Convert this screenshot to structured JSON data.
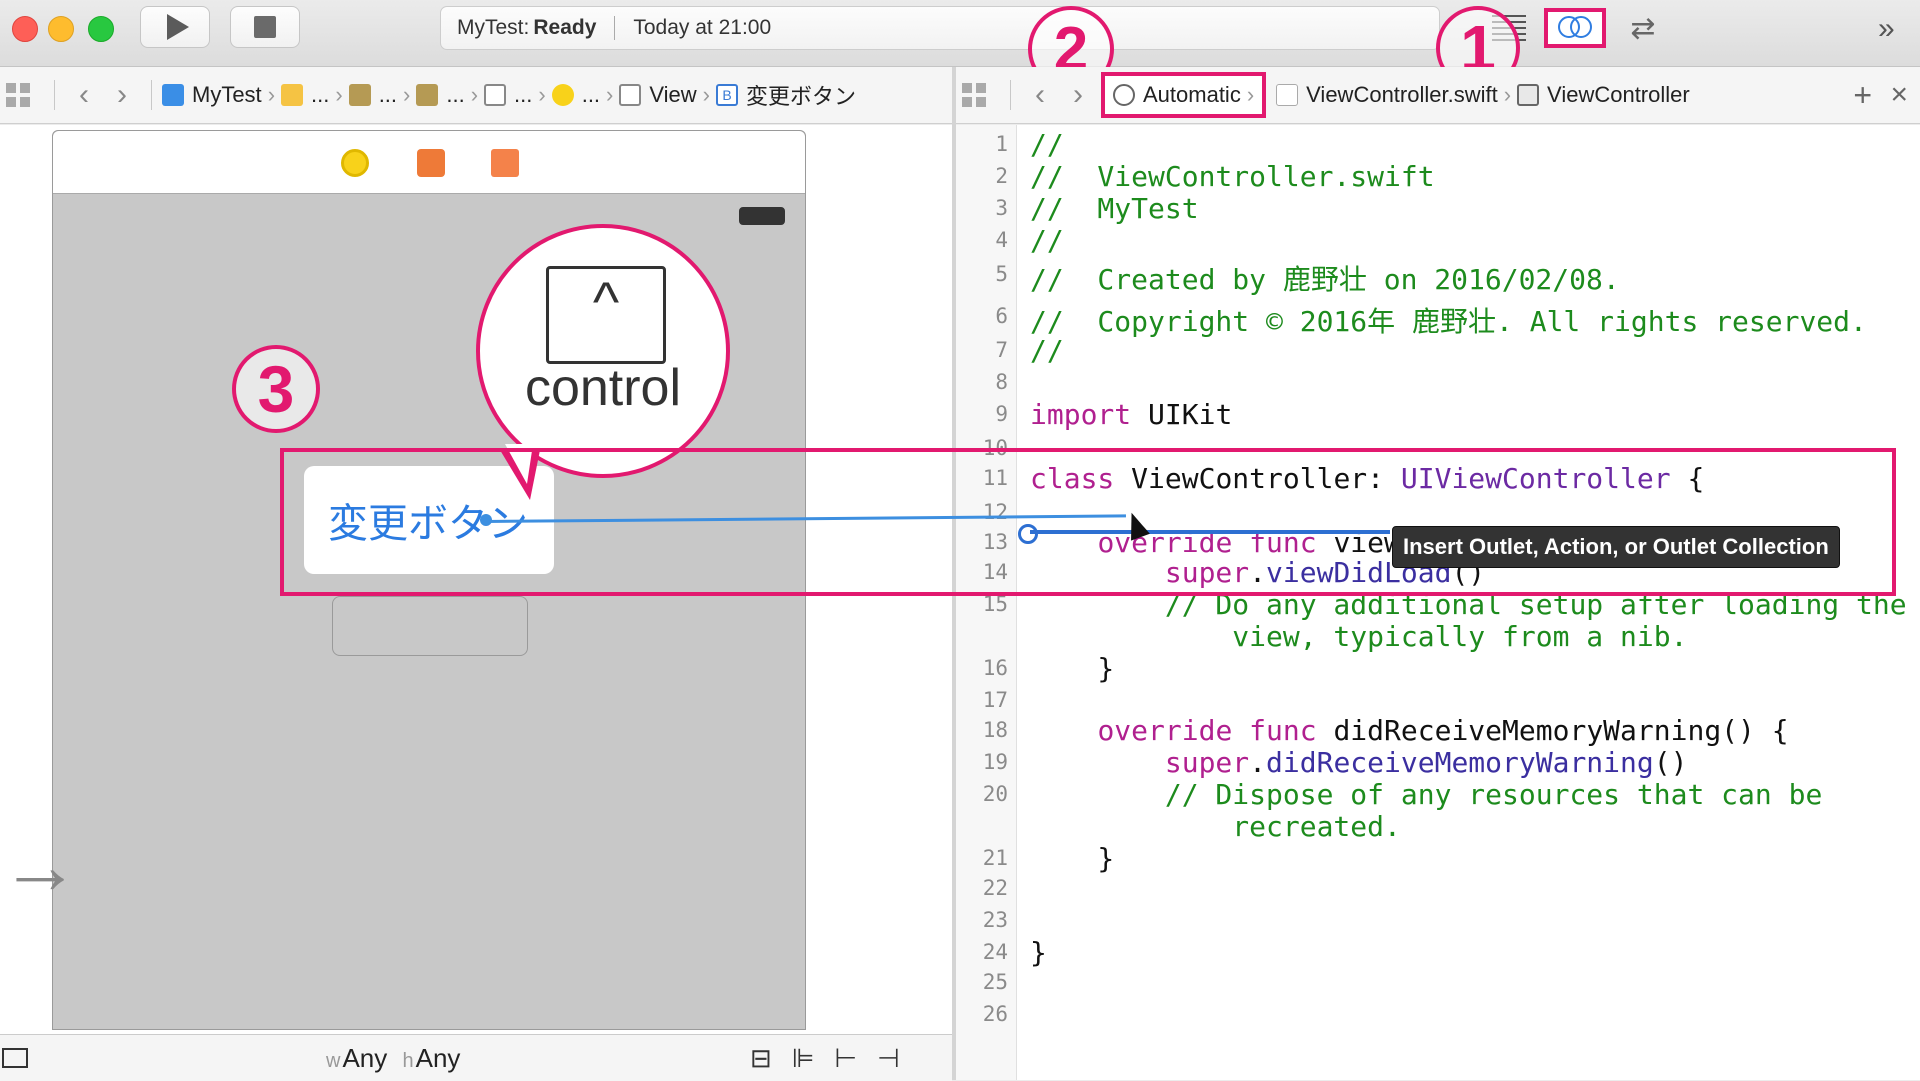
{
  "toolbar": {
    "scheme": "MyTest:",
    "status": "Ready",
    "time": "Today at 21:00"
  },
  "annotations": {
    "n1": "1",
    "n2": "2",
    "n3": "3",
    "key_symbol": "^",
    "key_label": "control"
  },
  "left_jumpbar": {
    "crumbs": [
      "MyTest",
      "...",
      "...",
      "...",
      "...",
      "...",
      "View",
      "変更ボタン"
    ]
  },
  "right_jumpbar": {
    "mode": "Automatic",
    "file": "ViewController.swift",
    "symbol": "ViewController"
  },
  "canvas": {
    "button_title": "変更ボタン",
    "size_w_label": "w",
    "size_w": "Any",
    "size_h_label": "h",
    "size_h": "Any"
  },
  "code_lines": [
    {
      "n": "1",
      "parts": [
        [
          "com",
          "//"
        ]
      ]
    },
    {
      "n": "2",
      "parts": [
        [
          "com",
          "//  ViewController.swift"
        ]
      ]
    },
    {
      "n": "3",
      "parts": [
        [
          "com",
          "//  MyTest"
        ]
      ]
    },
    {
      "n": "4",
      "parts": [
        [
          "com",
          "//"
        ]
      ]
    },
    {
      "n": "5",
      "parts": [
        [
          "com",
          "//  Created by 鹿野壮 on 2016/02/08."
        ]
      ]
    },
    {
      "n": "6",
      "parts": [
        [
          "com",
          "//  Copyright © 2016年 鹿野壮. All rights reserved."
        ]
      ]
    },
    {
      "n": "7",
      "parts": [
        [
          "com",
          "//"
        ]
      ]
    },
    {
      "n": "8",
      "parts": []
    },
    {
      "n": "9",
      "parts": [
        [
          "kw",
          "import"
        ],
        [
          "plain",
          " UIKit"
        ]
      ]
    },
    {
      "n": "10",
      "parts": []
    },
    {
      "n": "11",
      "parts": [
        [
          "kw",
          "class"
        ],
        [
          "plain",
          " ViewController: "
        ],
        [
          "type",
          "UIViewController"
        ],
        [
          "plain",
          " {"
        ]
      ]
    },
    {
      "n": "12",
      "parts": []
    },
    {
      "n": "13",
      "parts": [
        [
          "plain",
          "    "
        ],
        [
          "kw",
          "override func"
        ],
        [
          "plain",
          " view"
        ]
      ]
    },
    {
      "n": "14",
      "parts": [
        [
          "plain",
          "        "
        ],
        [
          "kw",
          "super"
        ],
        [
          "plain",
          "."
        ],
        [
          "call",
          "viewDidLoad"
        ],
        [
          "plain",
          "()"
        ]
      ]
    },
    {
      "n": "15",
      "parts": [
        [
          "com",
          "        // Do any additional setup after loading the"
        ]
      ]
    },
    {
      "n": "",
      "parts": [
        [
          "com",
          "            view, typically from a nib."
        ]
      ]
    },
    {
      "n": "16",
      "parts": [
        [
          "plain",
          "    }"
        ]
      ]
    },
    {
      "n": "17",
      "parts": []
    },
    {
      "n": "18",
      "parts": [
        [
          "plain",
          "    "
        ],
        [
          "kw",
          "override func"
        ],
        [
          "plain",
          " didReceiveMemoryWarning() {"
        ]
      ]
    },
    {
      "n": "19",
      "parts": [
        [
          "plain",
          "        "
        ],
        [
          "kw",
          "super"
        ],
        [
          "plain",
          "."
        ],
        [
          "call",
          "didReceiveMemoryWarning"
        ],
        [
          "plain",
          "()"
        ]
      ]
    },
    {
      "n": "20",
      "parts": [
        [
          "com",
          "        // Dispose of any resources that can be"
        ]
      ]
    },
    {
      "n": "",
      "parts": [
        [
          "com",
          "            recreated."
        ]
      ]
    },
    {
      "n": "21",
      "parts": [
        [
          "plain",
          "    }"
        ]
      ]
    },
    {
      "n": "22",
      "parts": []
    },
    {
      "n": "23",
      "parts": []
    },
    {
      "n": "24",
      "parts": [
        [
          "plain",
          "}"
        ]
      ]
    },
    {
      "n": "25",
      "parts": []
    },
    {
      "n": "26",
      "parts": []
    }
  ],
  "tooltip": "Insert Outlet, Action, or Outlet Collection",
  "colors": {
    "annotation": "#e2196f",
    "comment": "#1d8b1d",
    "keyword": "#b0208f",
    "type": "#6c2aa3",
    "link": "#2b7be0"
  },
  "icons": [
    "run-icon",
    "stop-icon",
    "standard-editor-icon",
    "assistant-editor-icon",
    "version-editor-icon",
    "related-items-icon",
    "add-editor-icon",
    "close-editor-icon"
  ]
}
